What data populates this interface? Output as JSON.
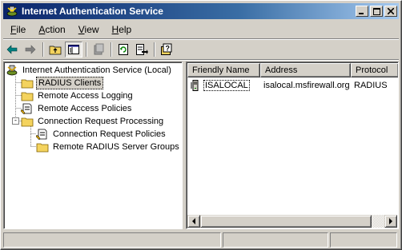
{
  "window": {
    "title": "Internet Authentication Service",
    "controls": [
      "minimize",
      "maximize",
      "close"
    ]
  },
  "menu": {
    "items": [
      {
        "label": "File",
        "accel": "F"
      },
      {
        "label": "Action",
        "accel": "A"
      },
      {
        "label": "View",
        "accel": "V"
      },
      {
        "label": "Help",
        "accel": "H"
      }
    ]
  },
  "toolbar": {
    "buttons": [
      "back-arrow-icon",
      "forward-arrow-icon",
      "up-folder-icon",
      "show-hide-tree-icon",
      "delete-icon",
      "refresh-icon",
      "export-list-icon",
      "help-icon"
    ],
    "pressed": "show-hide-tree-icon"
  },
  "tree": {
    "root": "Internet Authentication Service (Local)",
    "items": [
      {
        "label": "RADIUS Clients",
        "selected": true
      },
      {
        "label": "Remote Access Logging"
      },
      {
        "label": "Remote Access Policies"
      },
      {
        "label": "Connection Request Processing",
        "expander": "-"
      },
      {
        "label": "Connection Request Policies"
      },
      {
        "label": "Remote RADIUS Server Groups"
      }
    ]
  },
  "list": {
    "columns": [
      "Friendly Name",
      "Address",
      "Protocol"
    ],
    "rows": [
      {
        "name": "ISALOCAL",
        "address": "isalocal.msfirewall.org",
        "protocol": "RADIUS"
      }
    ]
  },
  "colors": {
    "titlebar_start": "#0a246a",
    "titlebar_end": "#a6caf0",
    "face": "#d4d0c8",
    "folder": "#f4d35e"
  }
}
